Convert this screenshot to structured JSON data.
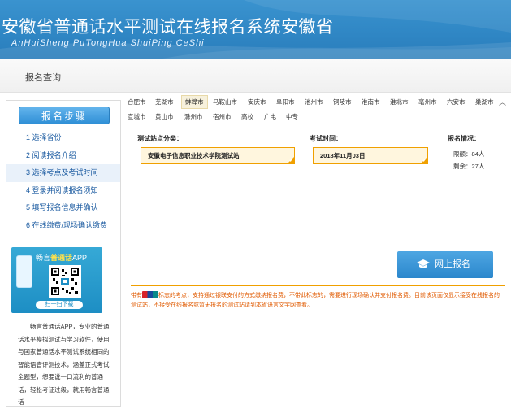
{
  "header": {
    "title": "安徽省普通话水平测试在线报名系统安徽省",
    "subtitle": "AnHuiSheng PuTongHua ShuiPing CeShi"
  },
  "breadcrumb": {
    "label": "报名查询"
  },
  "sidebar": {
    "steps_button": "报名步骤",
    "steps": [
      "1 选择省份",
      "2 阅读报名介绍",
      "3 选择考点及考试时间",
      "4 登录并阅读报名须知",
      "5 填写报名信息并确认",
      "6 在线缴费/现场确认缴费"
    ],
    "active_step": 2,
    "app_ad": {
      "title_prefix": "畅言",
      "title_highlight": "普通话",
      "title_suffix": "APP",
      "scan_label": "扫一扫下载"
    },
    "app_description": "畅言普通话APP，专业的普通话水平模拟测试与学习软件，使用与国家普通话水平测试系统相同的智能语音评测技术，涵盖正式考试全题型，想要说一口流利的普通话，轻松考证过级，就用畅言普通话"
  },
  "cities": {
    "row1": [
      "合肥市",
      "芜湖市",
      "蚌埠市",
      "马鞍山市",
      "安庆市",
      "阜阳市",
      "池州市",
      "铜陵市",
      "淮南市",
      "淮北市",
      "亳州市",
      "六安市",
      "巢湖市"
    ],
    "row2": [
      "宣城市",
      "黄山市",
      "滁州市",
      "宿州市",
      "高校",
      "广电",
      "中专"
    ],
    "selected": "蚌埠市",
    "collapse_icon": "chevron-up-icon"
  },
  "form": {
    "site_label": "测试站点分类：",
    "site_value": "安徽电子信息职业技术学院测试站",
    "time_label": "考试时间：",
    "time_value": "2018年11月03日",
    "status_label": "报名情况：",
    "quota": "限额：84人",
    "remaining": "剩余：27人"
  },
  "actions": {
    "signup_label": "网上报名",
    "signup_icon": "graduation-cap-icon"
  },
  "notice": {
    "prefix": "带有",
    "body": "标志的考点，支持通过银联支付的方式缴纳报名费，不带此标志的，需要进行现场确认并支付报名费。目前该页面仅显示接受在线报名的测试站，不接受在线报名或暂无报名的测试站请到本省语言文字网查看。"
  },
  "colors": {
    "accent_blue": "#2f86c4",
    "selected_orange": "#f0a000",
    "notice_text": "#e05a00"
  }
}
